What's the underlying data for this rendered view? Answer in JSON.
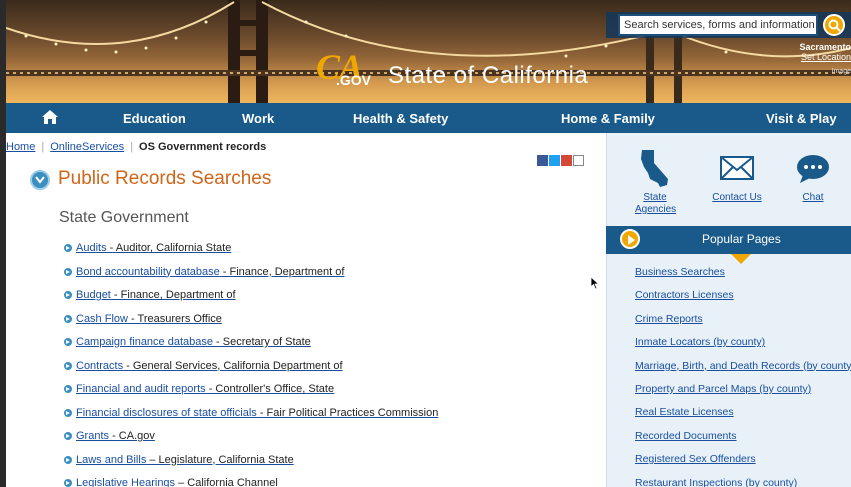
{
  "header": {
    "logo": {
      "ca": "CA",
      "gov": ".GOV",
      "state": "State of California"
    },
    "search_placeholder": "Search services, forms and information in",
    "location_name": "Sacramento",
    "location_link": "Set Location",
    "image_credit": "Image"
  },
  "nav": {
    "home_icon": "home-icon",
    "items": [
      "Education",
      "Work",
      "Health & Safety",
      "Home & Family",
      "Visit & Play"
    ]
  },
  "breadcrumb": {
    "home": "Home",
    "online": "OnlineServices",
    "current": "OS Government records"
  },
  "page": {
    "title": "Public Records Searches",
    "section": "State Government"
  },
  "records": [
    {
      "link": "Audits",
      "desc": " - Auditor, California State"
    },
    {
      "link": "Bond accountability database",
      "desc": " - Finance, Department of"
    },
    {
      "link": "Budget",
      "desc": " - Finance, Department of"
    },
    {
      "link": "Cash Flow",
      "desc": " - Treasurers Office"
    },
    {
      "link": "Campaign finance database",
      "desc": " - Secretary of State"
    },
    {
      "link": "Contracts",
      "desc": " - General Services, California Department of"
    },
    {
      "link": "Financial and audit reports",
      "desc": " - Controller's Office, State"
    },
    {
      "link": "Financial disclosures of state officials",
      "desc": " - Fair Political Practices Commission"
    },
    {
      "link": "Grants",
      "desc": " - CA.gov"
    },
    {
      "link": "Laws and Bills",
      "desc": " – Legislature, California State"
    },
    {
      "link": "Legislative Hearings",
      "desc": " – California Channel"
    }
  ],
  "sidebar": {
    "quick_links": [
      {
        "label_line1": "State",
        "label_line2": "Agencies",
        "icon": "california-map-icon"
      },
      {
        "label_line1": "Contact Us",
        "label_line2": "",
        "icon": "envelope-icon"
      },
      {
        "label_line1": "Chat",
        "label_line2": "",
        "icon": "chat-bubble-icon"
      }
    ],
    "popular_title": "Popular Pages",
    "popular": [
      "Business Searches",
      "Contractors Licenses",
      "Crime Reports",
      "Inmate Locators (by county)",
      "Marriage, Birth, and Death Records (by county)",
      "Property and Parcel Maps (by county)",
      "Real Estate Licenses",
      "Recorded Documents",
      "Registered Sex Offenders",
      "Restaurant Inspections (by county)"
    ]
  },
  "colors": {
    "nav_blue": "#195a8a",
    "link_blue": "#1a4fa0",
    "title_orange": "#d0651a",
    "accent_gold": "#f0a800",
    "sidebar_bg": "#e8f1f7"
  }
}
